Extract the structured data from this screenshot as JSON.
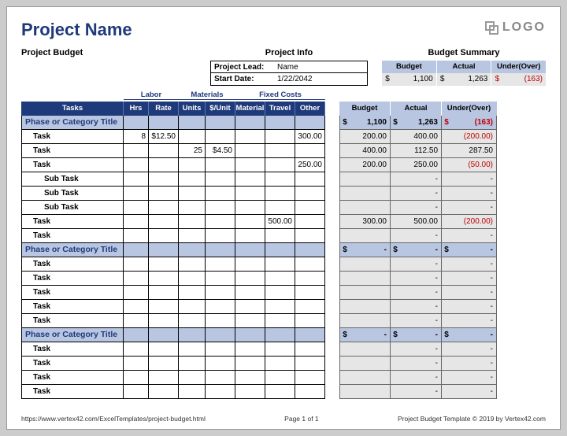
{
  "title": "Project Name",
  "subtitle": "Project Budget",
  "logo_text": "LOGO",
  "section_labels": {
    "project_info": "Project Info",
    "budget_summary": "Budget Summary"
  },
  "project_info": {
    "lead_label": "Project Lead:",
    "lead_value": "Name",
    "start_label": "Start Date:",
    "start_value": "1/22/2042"
  },
  "summary": {
    "headers": {
      "budget": "Budget",
      "actual": "Actual",
      "under": "Under(Over)"
    },
    "currency": "$",
    "budget": "1,100",
    "actual": "1,263",
    "under": "(163)"
  },
  "columns": {
    "tasks": "Tasks",
    "labor": "Labor",
    "materials": "Materials",
    "fixed": "Fixed Costs",
    "hrs": "Hrs",
    "rate": "Rate",
    "units": "Units",
    "unit_price": "$/Unit",
    "material": "Material",
    "travel": "Travel",
    "other": "Other",
    "budget": "Budget",
    "actual": "Actual",
    "under": "Under(Over)"
  },
  "phases": [
    {
      "title": "Phase or Category Title",
      "budget": "1,100",
      "actual": "1,263",
      "under": "(163)",
      "under_neg": true,
      "rows": [
        {
          "label": "Task",
          "hrs": "8",
          "rate": "$12.50",
          "units": "",
          "unitp": "",
          "mat": "",
          "trav": "",
          "oth": "300.00",
          "budget": "200.00",
          "actual": "400.00",
          "under": "(200.00)",
          "under_neg": true
        },
        {
          "label": "Task",
          "hrs": "",
          "rate": "",
          "units": "25",
          "unitp": "$4.50",
          "mat": "",
          "trav": "",
          "oth": "",
          "budget": "400.00",
          "actual": "112.50",
          "under": "287.50",
          "under_neg": false
        },
        {
          "label": "Task",
          "hrs": "",
          "rate": "",
          "units": "",
          "unitp": "",
          "mat": "",
          "trav": "",
          "oth": "250.00",
          "budget": "200.00",
          "actual": "250.00",
          "under": "(50.00)",
          "under_neg": true
        },
        {
          "label": "Sub Task",
          "sub": true,
          "hrs": "",
          "rate": "",
          "units": "",
          "unitp": "",
          "mat": "",
          "trav": "",
          "oth": "",
          "budget": "",
          "actual": "-",
          "under": "-",
          "under_neg": false
        },
        {
          "label": "Sub Task",
          "sub": true,
          "hrs": "",
          "rate": "",
          "units": "",
          "unitp": "",
          "mat": "",
          "trav": "",
          "oth": "",
          "budget": "",
          "actual": "-",
          "under": "-",
          "under_neg": false
        },
        {
          "label": "Sub Task",
          "sub": true,
          "hrs": "",
          "rate": "",
          "units": "",
          "unitp": "",
          "mat": "",
          "trav": "",
          "oth": "",
          "budget": "",
          "actual": "-",
          "under": "-",
          "under_neg": false
        },
        {
          "label": "Task",
          "hrs": "",
          "rate": "",
          "units": "",
          "unitp": "",
          "mat": "",
          "trav": "500.00",
          "oth": "",
          "budget": "300.00",
          "actual": "500.00",
          "under": "(200.00)",
          "under_neg": true
        },
        {
          "label": "Task",
          "hrs": "",
          "rate": "",
          "units": "",
          "unitp": "",
          "mat": "",
          "trav": "",
          "oth": "",
          "budget": "",
          "actual": "-",
          "under": "-",
          "under_neg": false
        }
      ]
    },
    {
      "title": "Phase or Category Title",
      "budget": "-",
      "actual": "-",
      "under": "-",
      "under_neg": false,
      "rows": [
        {
          "label": "Task",
          "hrs": "",
          "rate": "",
          "units": "",
          "unitp": "",
          "mat": "",
          "trav": "",
          "oth": "",
          "budget": "",
          "actual": "-",
          "under": "-",
          "under_neg": false
        },
        {
          "label": "Task",
          "hrs": "",
          "rate": "",
          "units": "",
          "unitp": "",
          "mat": "",
          "trav": "",
          "oth": "",
          "budget": "",
          "actual": "-",
          "under": "-",
          "under_neg": false
        },
        {
          "label": "Task",
          "hrs": "",
          "rate": "",
          "units": "",
          "unitp": "",
          "mat": "",
          "trav": "",
          "oth": "",
          "budget": "",
          "actual": "-",
          "under": "-",
          "under_neg": false
        },
        {
          "label": "Task",
          "hrs": "",
          "rate": "",
          "units": "",
          "unitp": "",
          "mat": "",
          "trav": "",
          "oth": "",
          "budget": "",
          "actual": "-",
          "under": "-",
          "under_neg": false
        },
        {
          "label": "Task",
          "hrs": "",
          "rate": "",
          "units": "",
          "unitp": "",
          "mat": "",
          "trav": "",
          "oth": "",
          "budget": "",
          "actual": "-",
          "under": "-",
          "under_neg": false
        }
      ]
    },
    {
      "title": "Phase or Category Title",
      "budget": "-",
      "actual": "-",
      "under": "-",
      "under_neg": false,
      "rows": [
        {
          "label": "Task",
          "hrs": "",
          "rate": "",
          "units": "",
          "unitp": "",
          "mat": "",
          "trav": "",
          "oth": "",
          "budget": "",
          "actual": "-",
          "under": "-",
          "under_neg": false
        },
        {
          "label": "Task",
          "hrs": "",
          "rate": "",
          "units": "",
          "unitp": "",
          "mat": "",
          "trav": "",
          "oth": "",
          "budget": "",
          "actual": "-",
          "under": "-",
          "under_neg": false
        },
        {
          "label": "Task",
          "hrs": "",
          "rate": "",
          "units": "",
          "unitp": "",
          "mat": "",
          "trav": "",
          "oth": "",
          "budget": "",
          "actual": "-",
          "under": "-",
          "under_neg": false
        },
        {
          "label": "Task",
          "hrs": "",
          "rate": "",
          "units": "",
          "unitp": "",
          "mat": "",
          "trav": "",
          "oth": "",
          "budget": "",
          "actual": "-",
          "under": "-",
          "under_neg": false
        }
      ]
    }
  ],
  "footer": {
    "url": "https://www.vertex42.com/ExcelTemplates/project-budget.html",
    "page": "Page 1 of 1",
    "copyright": "Project Budget Template © 2019 by Vertex42.com"
  }
}
